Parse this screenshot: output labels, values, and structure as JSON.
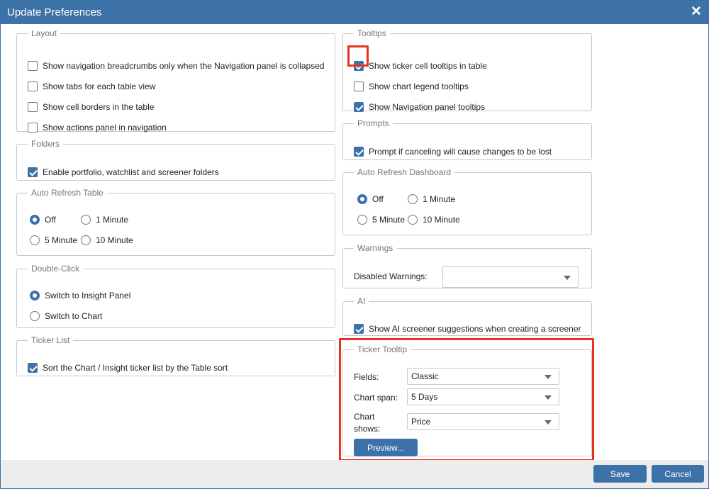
{
  "window": {
    "title": "Update Preferences",
    "close_icon": "close-icon"
  },
  "layout": {
    "legend": "Layout",
    "items": [
      {
        "label": "Show navigation breadcrumbs only when the Navigation panel is collapsed",
        "checked": false
      },
      {
        "label": "Show tabs for each table view",
        "checked": false
      },
      {
        "label": "Show cell borders in the table",
        "checked": false
      },
      {
        "label": "Show actions panel in navigation",
        "checked": false
      }
    ]
  },
  "folders": {
    "legend": "Folders",
    "items": [
      {
        "label": "Enable portfolio, watchlist and screener folders",
        "checked": true
      }
    ]
  },
  "auto_refresh_table": {
    "legend": "Auto Refresh Table",
    "options": [
      "Off",
      "1 Minute",
      "5 Minute",
      "10 Minute"
    ],
    "selected": "Off"
  },
  "double_click": {
    "legend": "Double-Click",
    "options": [
      "Switch to Insight Panel",
      "Switch to Chart"
    ],
    "selected": "Switch to Insight Panel"
  },
  "ticker_list": {
    "legend": "Ticker List",
    "items": [
      {
        "label": "Sort the Chart / Insight ticker list by the Table sort",
        "checked": true
      }
    ]
  },
  "tooltips": {
    "legend": "Tooltips",
    "items": [
      {
        "label": "Show ticker cell tooltips in table",
        "checked": true
      },
      {
        "label": "Show chart legend tooltips",
        "checked": false
      },
      {
        "label": "Show Navigation panel tooltips",
        "checked": true
      }
    ]
  },
  "prompts": {
    "legend": "Prompts",
    "items": [
      {
        "label": "Prompt if canceling will cause changes to be lost",
        "checked": true
      }
    ]
  },
  "auto_refresh_dashboard": {
    "legend": "Auto Refresh Dashboard",
    "options": [
      "Off",
      "1 Minute",
      "5 Minute",
      "10 Minute"
    ],
    "selected": "Off"
  },
  "warnings": {
    "legend": "Warnings",
    "disabled_label": "Disabled Warnings:",
    "disabled_value": ""
  },
  "ai": {
    "legend": "AI",
    "items": [
      {
        "label": "Show AI screener suggestions when creating a screener",
        "checked": true
      }
    ]
  },
  "ticker_tooltip": {
    "legend": "Ticker Tooltip",
    "fields_label": "Fields:",
    "fields_value": "Classic",
    "chart_span_label": "Chart span:",
    "chart_span_value": "5 Days",
    "chart_shows_label_1": "Chart",
    "chart_shows_label_2": "shows:",
    "chart_shows_value": "Price",
    "preview_label": "Preview..."
  },
  "footer": {
    "save_label": "Save",
    "cancel_label": "Cancel"
  },
  "colors": {
    "accent": "#3d72a8",
    "highlight": "#e8321f"
  }
}
